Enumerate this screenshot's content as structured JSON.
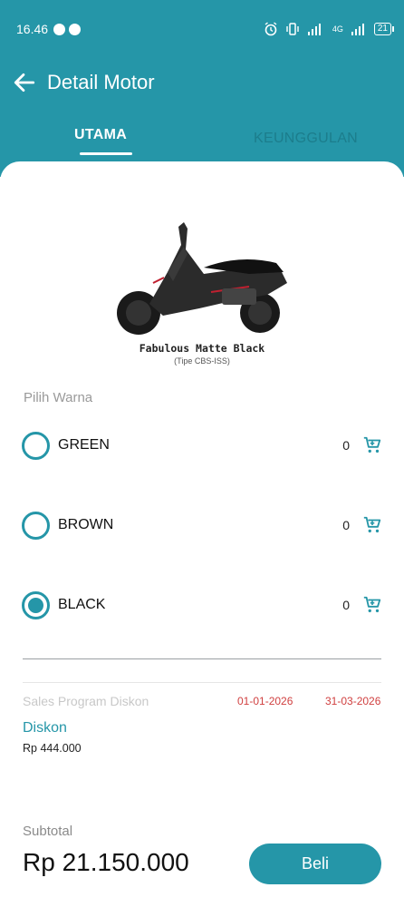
{
  "status_bar": {
    "time": "16.46",
    "network": "4G",
    "battery": "21"
  },
  "app_bar": {
    "title": "Detail Motor"
  },
  "tabs": [
    {
      "label": "UTAMA",
      "active": true
    },
    {
      "label": "KEUNGGULAN",
      "active": false
    }
  ],
  "product": {
    "name": "Fabulous Matte Black",
    "type": "(Tipe CBS-ISS)"
  },
  "color_section": {
    "label": "Pilih Warna"
  },
  "colors": [
    {
      "name": "GREEN",
      "qty": "0",
      "selected": false
    },
    {
      "name": "BROWN",
      "qty": "0",
      "selected": false
    },
    {
      "name": "BLACK",
      "qty": "0",
      "selected": true
    }
  ],
  "sales_program": {
    "label": "Sales Program Diskon",
    "start_date": "01-01-2026",
    "end_date": "31-03-2026",
    "diskon_label": "Diskon",
    "diskon_value": "Rp 444.000"
  },
  "subtotal": {
    "label": "Subtotal",
    "value": "Rp 21.150.000"
  },
  "buy_button": {
    "label": "Beli"
  },
  "colors_theme": {
    "primary": "#2596a8",
    "date_red": "#d04040"
  },
  "icons": [
    "whatsapp-icon",
    "message-icon",
    "alarm-icon",
    "vibrate-icon",
    "signal-icon",
    "battery-icon",
    "back-arrow-icon",
    "cart-icon"
  ]
}
